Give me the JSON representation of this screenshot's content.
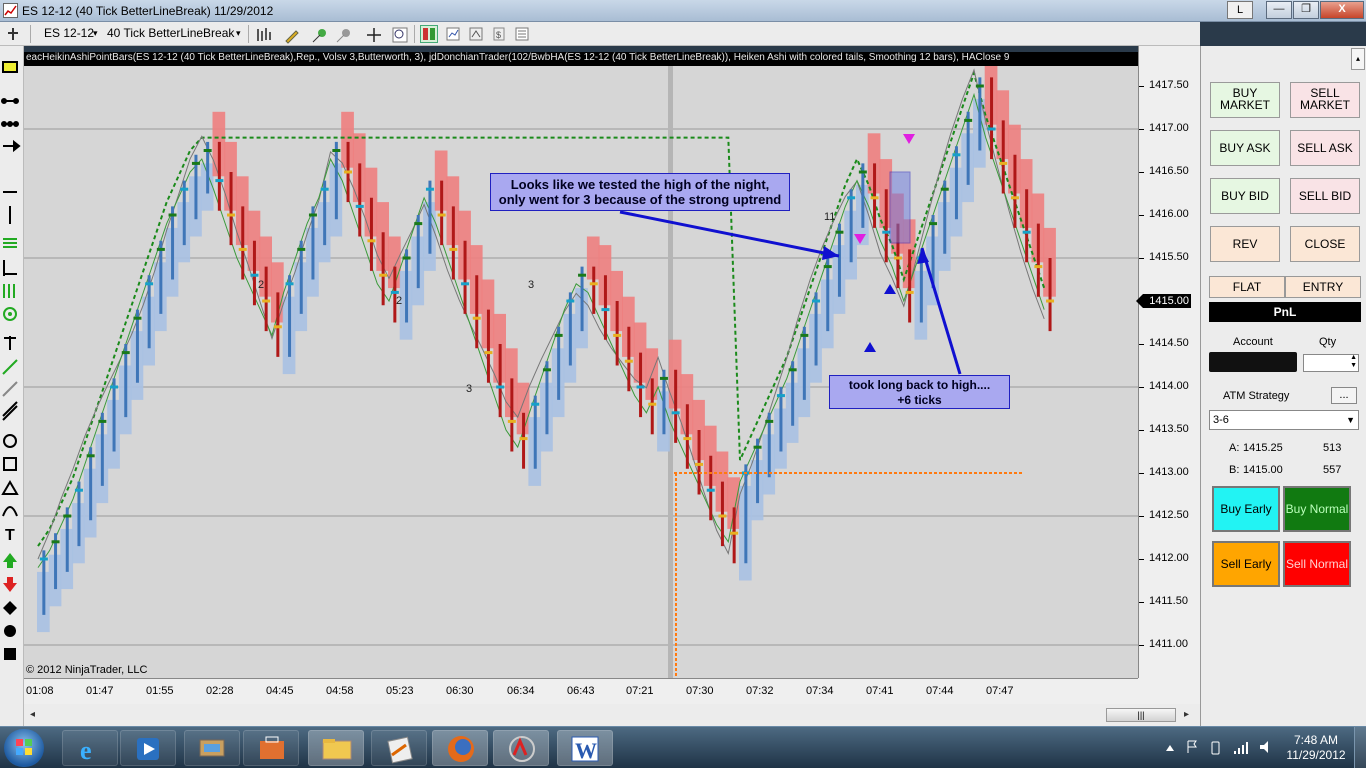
{
  "window": {
    "title": "ES 12-12 (40 Tick BetterLineBreak)  11/29/2012",
    "letter_button": "L",
    "minimize": "—",
    "restore": "❐",
    "close": "X"
  },
  "toolbar": {
    "instrument": "ES 12-12",
    "instrument_arrow": "▾",
    "interval": "40 Tick BetterLineBreak",
    "interval_arrow": "▾"
  },
  "chart": {
    "header_text": "eacHeikinAshiPointBars(ES 12-12 (40 Tick BetterLineBreak),Rep., Volsv 3,Butterworth, 3), jdDonchianTrader(102/BwbHA(ES 12-12 (40 Tick BetterLineBreak)), Heiken Ashi with colored tails, Smoothing 12 bars), HAClose 9",
    "copyright": "© 2012 NinjaTrader, LLC",
    "y_ticks": [
      "1417.50",
      "1417.00",
      "1416.50",
      "1416.00",
      "1415.50",
      "1415.00",
      "1414.50",
      "1414.00",
      "1413.50",
      "1413.00",
      "1412.50",
      "1412.00",
      "1411.50",
      "1411.00"
    ],
    "current_price": "1415.00",
    "x_ticks": [
      "01:08",
      "01:47",
      "01:55",
      "02:28",
      "04:45",
      "04:58",
      "05:23",
      "06:30",
      "06:34",
      "06:43",
      "07:21",
      "07:30",
      "07:32",
      "07:34",
      "07:41",
      "07:44",
      "07:47"
    ],
    "bar_labels": [
      "2",
      "11",
      "3",
      "2",
      "3"
    ],
    "scroll_thumb": "|||",
    "scroll_left": "◂",
    "scroll_right": "▸",
    "annotation_1": {
      "line1": "Looks like we tested the high of the night,",
      "line2": "only went for 3 because of the strong uptrend"
    },
    "annotation_2": {
      "line1": "took long back to high....",
      "line2": "+6 ticks"
    },
    "colors": {
      "background": "#d6d6d6",
      "up_bar": "#3f76b8",
      "down_bar": "#b01818",
      "donchian": "#1a8a1a",
      "trail_up": "#a9c1e3",
      "trail_down": "#ee7f7f",
      "annotation": "#a9a8f0"
    }
  },
  "order_panel": {
    "buy_market": "BUY MARKET",
    "sell_market": "SELL MARKET",
    "buy_ask": "BUY ASK",
    "sell_ask": "SELL ASK",
    "buy_bid": "BUY BID",
    "sell_bid": "SELL BID",
    "rev": "REV",
    "close": "CLOSE",
    "flat": "FLAT",
    "entry": "ENTRY",
    "pnl": "PnL",
    "account_label": "Account",
    "qty_label": "Qty",
    "atm_label": "ATM Strategy",
    "atm_dots": "...",
    "atm_value": "3-6",
    "ask_label": "A:",
    "ask_price": "1415.25",
    "ask_size": "513",
    "bid_label": "B:",
    "bid_price": "1415.00",
    "bid_size": "557",
    "buy_early": "Buy Early",
    "buy_normal": "Buy Normal",
    "sell_early": "Sell Early",
    "sell_normal": "Sell Normal"
  },
  "taskbar": {
    "time": "7:48 AM",
    "date": "11/29/2012",
    "apps": [
      "internet-explorer",
      "media-player",
      "network",
      "toolbox",
      "file-explorer",
      "editor",
      "firefox",
      "ninjatrader",
      "word"
    ]
  }
}
